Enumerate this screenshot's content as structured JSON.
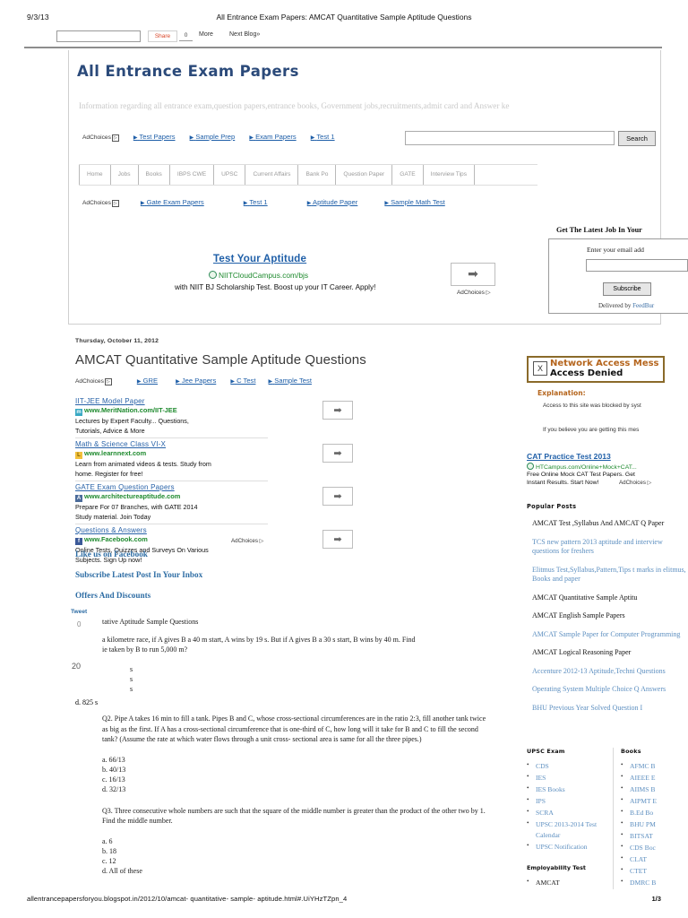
{
  "print": {
    "date": "9/3/13",
    "title": "All Entrance Exam Papers: AMCAT Quantitative Sample Aptitude Questions",
    "footer_url": "allentrancepapersforyou.blogspot.in/2012/10/amcat- quantitative- sample- aptitude.html#.UiYHzTZpn_4",
    "page_number": "1/3"
  },
  "blogger_bar": {
    "search_value": "",
    "share_label": "Share",
    "share_count": "0",
    "more_label": "More",
    "next_blog_label": "Next Blog»"
  },
  "blog": {
    "title": "All Entrance Exam Papers",
    "description": "Information regarding all entrance exam,question papers,entrance books, Government jobs,recruitments,admit card and Answer ke"
  },
  "search": {
    "value": "",
    "button_label": "Search"
  },
  "ads_top": {
    "adchoices_label": "AdChoices",
    "links": [
      "Test Papers",
      "Sample Prep",
      "Exam Papers",
      "Test 1"
    ]
  },
  "ads_second": {
    "adchoices_label": "AdChoices",
    "links": [
      "Gate Exam Papers",
      "Test 1",
      "Aptitude Paper",
      "Sample Math Test"
    ]
  },
  "menu": {
    "items": [
      "Home",
      "Jobs",
      "Books",
      "IBPS CWE",
      "UPSC",
      "Current Affairs",
      "Bank Po",
      "Question Paper",
      "GATE",
      "Interview Tips"
    ]
  },
  "big_ad": {
    "title": "Test Your Aptitude",
    "url": "NIITCloudCampus.com/bjs",
    "subtitle": "with NIIT BJ Scholarship Test. Boost up your IT Career. Apply!",
    "adchoices_label": "AdChoices",
    "arrow": "➡"
  },
  "subscribe": {
    "heading": "Get The Latest Job In Your",
    "label": "Enter your email add",
    "input_value": "",
    "button_label": "Subscribe",
    "delivered_prefix": "Delivered by ",
    "delivered_by": "FeedBur"
  },
  "post": {
    "date": "Thursday, October 11, 2012",
    "title": "AMCAT Quantitative Sample Aptitude Questions",
    "ads_inline_links": [
      "GRE",
      "Jee Papers",
      "C Test",
      "Sample Test"
    ],
    "adchoices_label": "AdChoices"
  },
  "ad_list": {
    "adchoices_label": "AdChoices",
    "items": [
      {
        "headline": "IIT-JEE Model Paper",
        "url": "www.MeritNation.com/IIT-JEE",
        "favicon": "m",
        "favicon_class": "fav-m",
        "desc_line1": "Lectures by Expert Faculty... Questions,",
        "desc_line2": "Tutorials, Advice & More",
        "arrow": "➡"
      },
      {
        "headline": "Math & Science Class VI-X",
        "url": "www.learnnext.com",
        "favicon": "L",
        "favicon_class": "fav-y",
        "desc_line1": "Learn from animated videos & tests. Study from",
        "desc_line2": "home. Register for free!",
        "arrow": "➡"
      },
      {
        "headline": "GATE Exam Question Papers",
        "url": "www.architectureaptitude.com",
        "favicon": "A",
        "favicon_class": "fav-b",
        "desc_line1": "Prepare For 07 Branches, with GATE 2014",
        "desc_line2": "Study material. Join Today",
        "arrow": "➡"
      },
      {
        "headline": "Questions & Answers",
        "url": "www.Facebook.com",
        "favicon": "f",
        "favicon_class": "fav-f",
        "desc_line1": "Online Tests, Quizzes and Surveys On Various",
        "desc_line2": "Subjects. Sign Up now!",
        "arrow": "➡"
      }
    ]
  },
  "social": {
    "facebook_heading": "Like us on Facebook",
    "subscribe_heading": "Subscribe Latest Post In Your Inbox",
    "offers_heading": "Offers And Discounts",
    "tweet_label": "Tweet",
    "tweet_count": "0",
    "twenty_label": "20"
  },
  "content": {
    "q1_heading_fragment": "tative Aptitude Sample Questions",
    "q1_line1": "a kilometre race, if A gives B a 40 m start, A wins by 19 s. But if A gives B a 30 s start, B wins by 40 m. Find",
    "q1_line2": "ie taken by B to run 5,000 m?",
    "q1_opt_a": "s",
    "q1_opt_b": "s",
    "q1_opt_c": "s",
    "q1_opt_d": "d. 825 s",
    "q2_text": "Q2. Pipe A takes 16 min to fill a tank. Pipes B and C, whose cross-sectional circumferences are in the ratio 2:3, fill another tank twice as big as the first. If A has a cross-sectional circumference that is one-third of C, how long will it take for B and C to fill the second tank? (Assume the rate at which water flows through a unit cross- sectional area is same for all the three pipes.)",
    "q2_options": [
      "a. 66/13",
      "b. 40/13",
      "c. 16/13",
      "d. 32/13"
    ],
    "q3_text": "Q3. Three consecutive whole numbers are such that the square of the middle number is greater than the product of the other two by 1. Find the middle number.",
    "q3_options": [
      "a. 6",
      "b. 18",
      "c. 12",
      "d. All of these"
    ]
  },
  "sidebar": {
    "network_access": {
      "close_icon": "X",
      "title": "Network Access Mess",
      "subtitle": "Access Denied",
      "explanation_label": "Explanation:",
      "line1": "Access to this site was blocked by syst",
      "line2": "If you believe you are getting this mes"
    },
    "cat_ad": {
      "title": "CAT Practice Test 2013",
      "url": "HTCampus.com/Online+Mock+CAT...",
      "desc1": "Free Online Mock CAT Test Papers. Get",
      "desc2": "Instant Results. Start Now!",
      "adchoices_label": "AdChoices"
    },
    "popular_posts": {
      "heading": "Popular Posts",
      "items": [
        {
          "text": "AMCAT Test ,Syllabus And AMCAT Q Paper",
          "link": false
        },
        {
          "text": "TCS new pattern 2013 aptitude and interview questions for freshers",
          "link": true
        },
        {
          "text": "Elitmus Test,Syllabus,Pattern,Tips t marks in elitmus, Books and paper",
          "link": true
        },
        {
          "text": "AMCAT Quantitative Sample Aptitu",
          "link": false
        },
        {
          "text": "AMCAT English Sample Papers",
          "link": false
        },
        {
          "text": "AMCAT Sample Paper for Computer Programming",
          "link": true
        },
        {
          "text": "AMCAT Logical Reasoning Paper",
          "link": false
        },
        {
          "text": "Accenture 2012-13 Aptitude,Techni Questions",
          "link": true
        },
        {
          "text": "Operating System Multiple Choice Q Answers",
          "link": true
        },
        {
          "text": "BHU Previous Year Solved Question I",
          "link": true
        }
      ]
    },
    "upsc": {
      "heading": "UPSC Exam",
      "items": [
        "CDS",
        "IES",
        "IES Books",
        "IPS",
        "SCRA",
        "UPSC 2013-2014 Test Calendar",
        "UPSC Notification"
      ],
      "heading2": "Employability Test",
      "items2": [
        "AMCAT"
      ]
    },
    "books": {
      "heading": "Books",
      "items": [
        "AFMC B",
        "AIEEE E",
        "AIIMS B",
        "AIPMT E",
        "B.Ed Bo",
        "BHU PM",
        "BITSAT",
        "CDS Boc",
        "CLAT",
        "CTET",
        "DMRC B"
      ]
    }
  }
}
